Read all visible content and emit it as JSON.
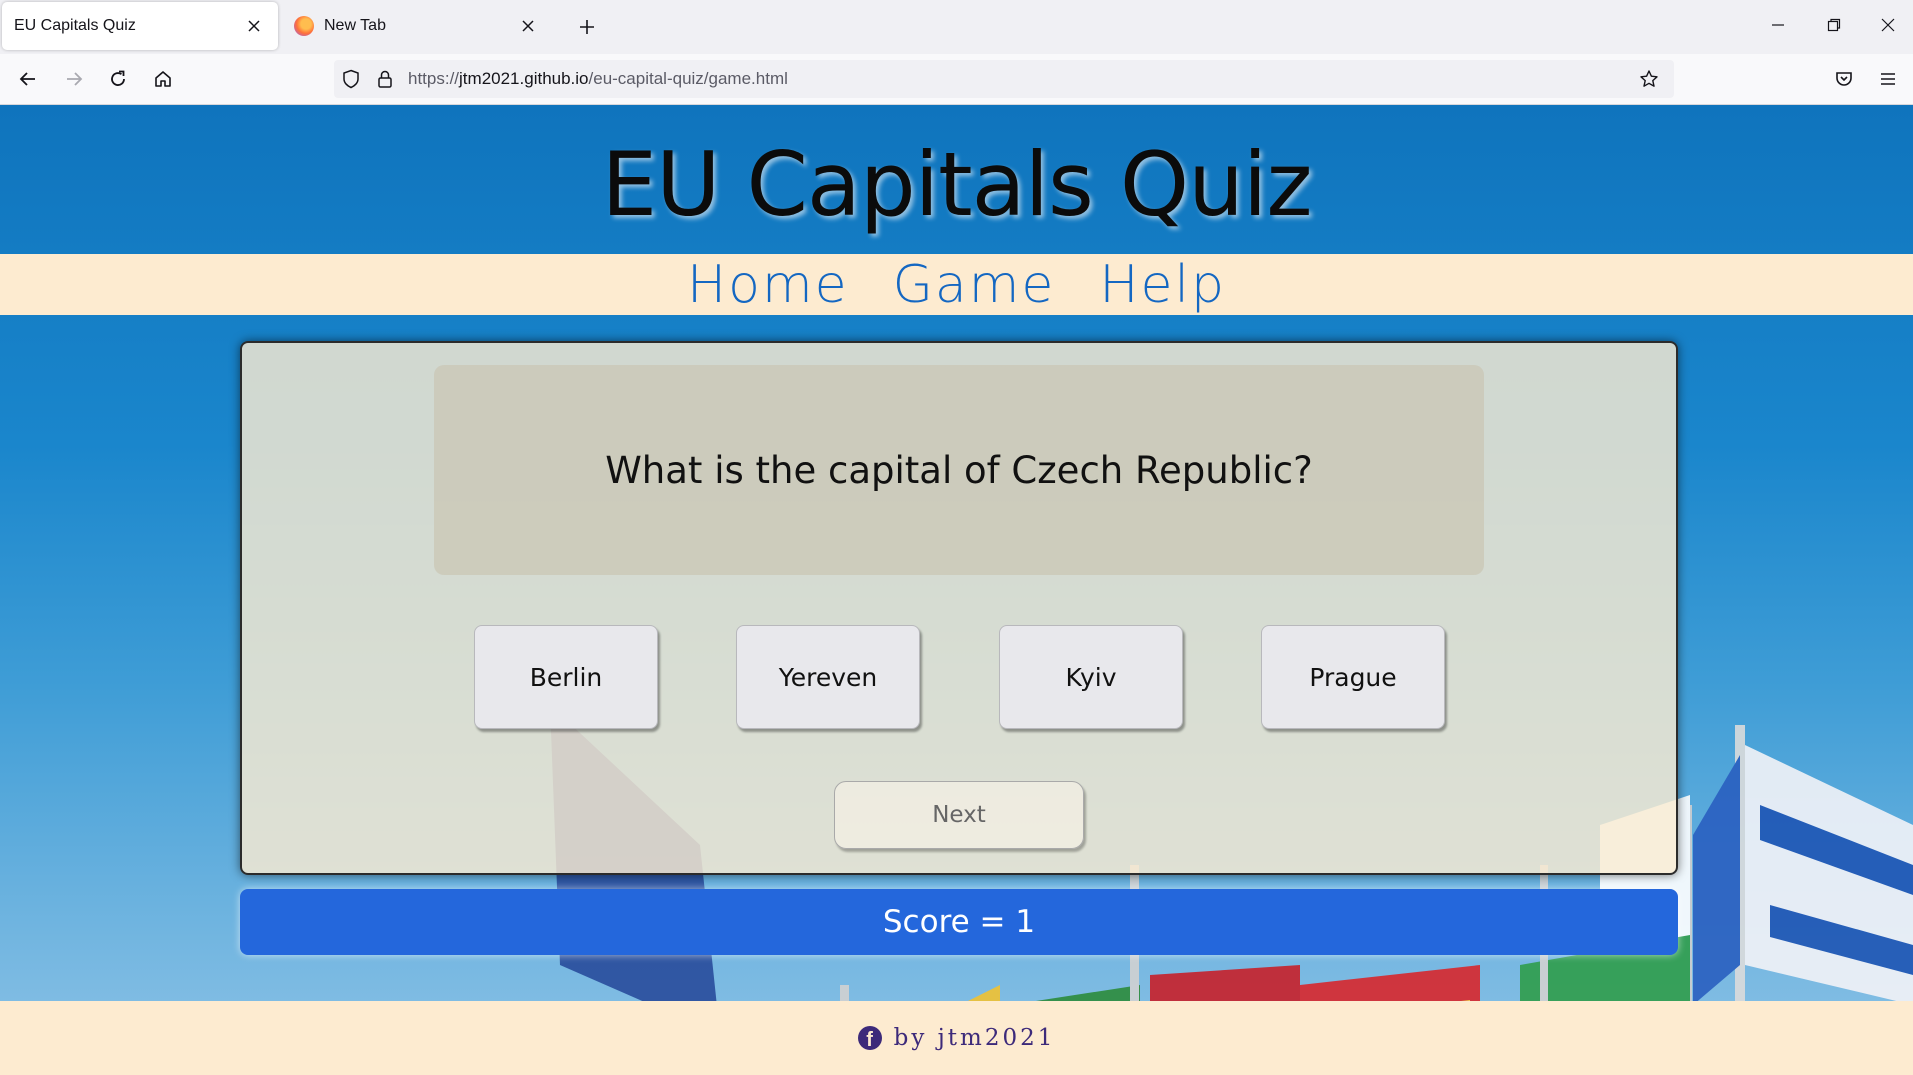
{
  "browser": {
    "tabs": [
      {
        "title": "EU Capitals Quiz",
        "active": true
      },
      {
        "title": "New Tab",
        "active": false
      }
    ],
    "url_prefix": "https://",
    "url_host": "jtm2021.github.io",
    "url_path": "/eu-capital-quiz/game.html",
    "icons": [
      "close-icon",
      "plus-icon",
      "minimize-icon",
      "restore-icon",
      "back-icon",
      "forward-icon",
      "reload-icon",
      "home-icon",
      "shield-icon",
      "lock-icon",
      "star-icon",
      "pocket-icon",
      "menu-icon"
    ]
  },
  "site": {
    "title": "EU Capitals Quiz",
    "nav": [
      "Home",
      "Game",
      "Help"
    ]
  },
  "quiz": {
    "question": "What is the capital of Czech Republic?",
    "answers": [
      "Berlin",
      "Yereven",
      "Kyiv",
      "Prague"
    ],
    "next_label": "Next",
    "score_text": "Score = 1"
  },
  "footer": {
    "text": "by jtm2021",
    "icon": "facebook-icon"
  },
  "colors": {
    "header_blue": "#0f74bd",
    "nav_cream": "#fdebd0",
    "nav_link": "#1467c2",
    "score_blue": "#2467dc",
    "footer_text": "#3d2a7a"
  }
}
